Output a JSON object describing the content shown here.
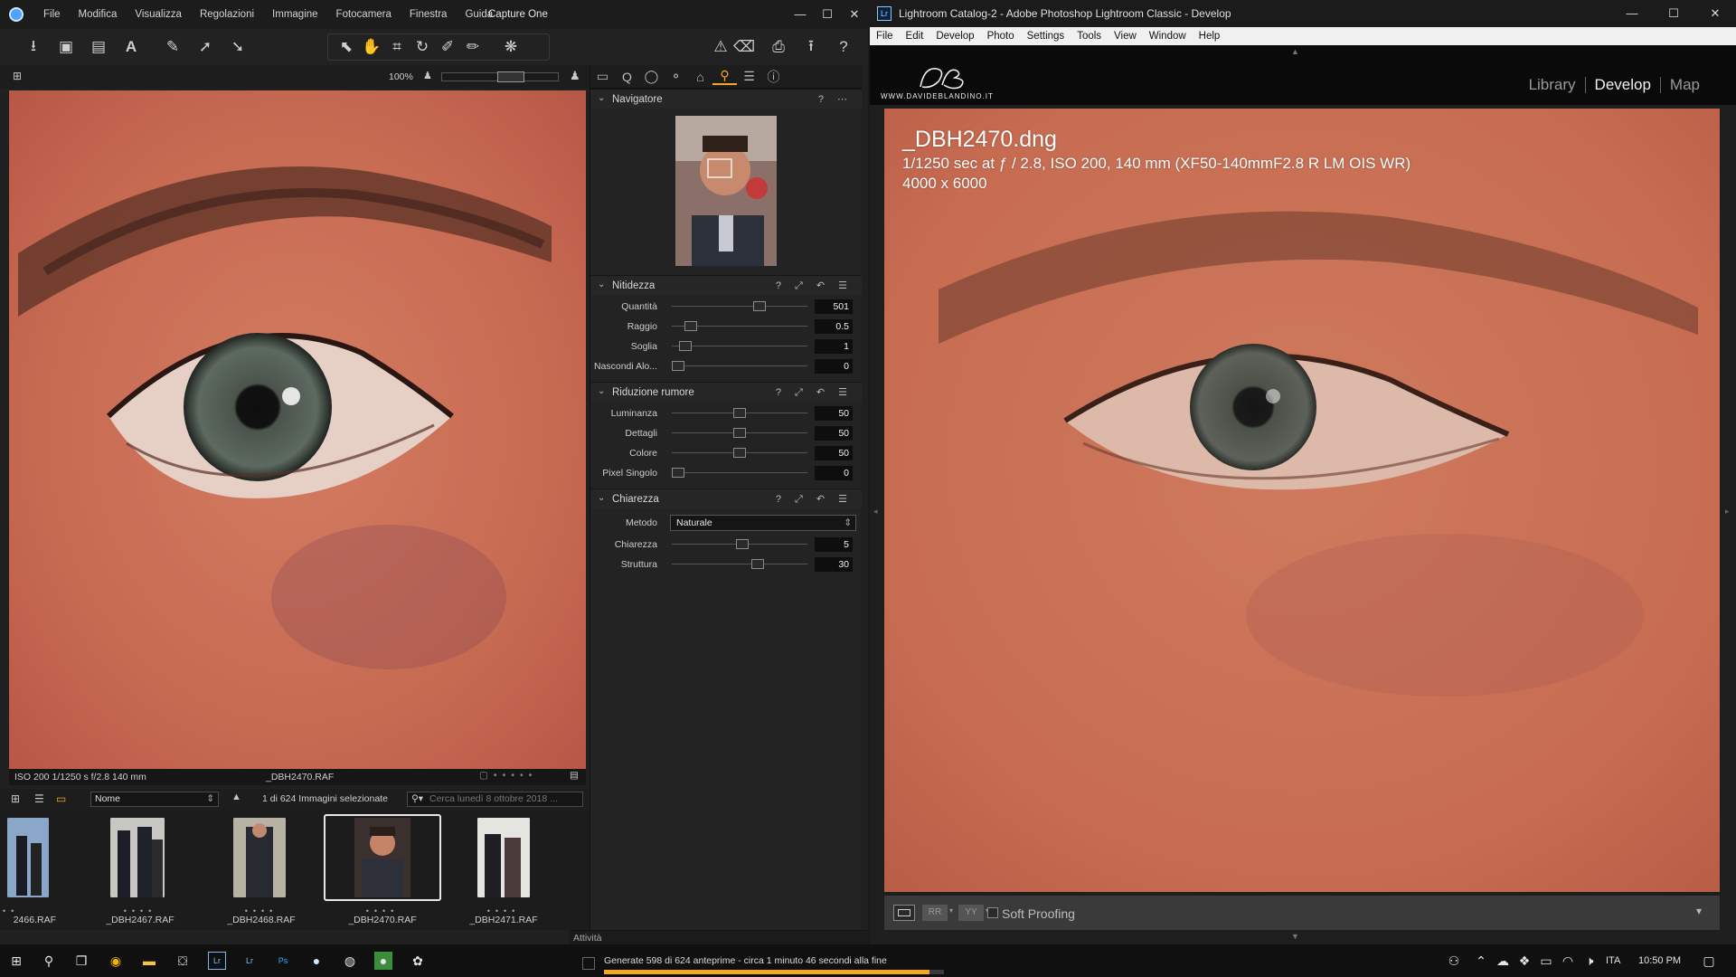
{
  "c1": {
    "menu": [
      "File",
      "Modifica",
      "Visualizza",
      "Regolazioni",
      "Immagine",
      "Fotocamera",
      "Finestra",
      "Guida"
    ],
    "app_title": "Capture One",
    "zoom": "100%",
    "viewer_meta": "ISO 200  1/1250 s  f/2.8  140 mm",
    "viewer_filename": "_DBH2470.RAF",
    "sort_value": "Nome",
    "count_label": "1 di 624 Immagini selezionate",
    "search_placeholder": "Cerca lunedì 8 ottobre 2018 ...",
    "thumbs": [
      "2466.RAF",
      "_DBH2467.RAF",
      "_DBH2468.RAF",
      "_DBH2470.RAF",
      "_DBH2471.RAF"
    ],
    "panel": {
      "navigator_title": "Navigatore",
      "sharpness": {
        "title": "Nitidezza",
        "rows": [
          {
            "label": "Quantità",
            "value": "501",
            "pos": 0.66
          },
          {
            "label": "Raggio",
            "value": "0.5",
            "pos": 0.1
          },
          {
            "label": "Soglia",
            "value": "1",
            "pos": 0.06
          },
          {
            "label": "Nascondi Alo...",
            "value": "0",
            "pos": 0.0
          }
        ]
      },
      "noise": {
        "title": "Riduzione rumore",
        "rows": [
          {
            "label": "Luminanza",
            "value": "50",
            "pos": 0.5
          },
          {
            "label": "Dettagli",
            "value": "50",
            "pos": 0.5
          },
          {
            "label": "Colore",
            "value": "50",
            "pos": 0.5
          },
          {
            "label": "Pixel Singolo",
            "value": "0",
            "pos": 0.0
          }
        ]
      },
      "clarity": {
        "title": "Chiarezza",
        "method_label": "Metodo",
        "method_value": "Naturale",
        "rows": [
          {
            "label": "Chiarezza",
            "value": "5",
            "pos": 0.52
          },
          {
            "label": "Struttura",
            "value": "30",
            "pos": 0.65
          }
        ]
      }
    },
    "activity_label": "Attività",
    "activity_text": "Generate 598 di 624 anteprime - circa 1 minuto 46 secondi alla fine",
    "activity_progress": 0.958
  },
  "lr": {
    "title": "Lightroom Catalog-2 - Adobe Photoshop Lightroom Classic - Develop",
    "icon": "Lr",
    "menu": [
      "File",
      "Edit",
      "Develop",
      "Photo",
      "Settings",
      "Tools",
      "View",
      "Window",
      "Help"
    ],
    "logo_site": "WWW.DAVIDEBLANDINO.IT",
    "modules": [
      "Library",
      "Develop",
      "Map"
    ],
    "active_module": "Develop",
    "info_filename": "_DBH2470.dng",
    "info_exposure": "1/1250 sec at ƒ / 2.8, ISO 200, 140 mm (XF50-140mmF2.8 R LM OIS WR)",
    "info_dims": "4000 x 6000",
    "soft_proofing": "Soft Proofing"
  },
  "taskbar": {
    "language": "ITA",
    "time": "10:50 PM"
  },
  "colors": {
    "skin": "#c96f57",
    "accent_orange": "#f5a623"
  }
}
